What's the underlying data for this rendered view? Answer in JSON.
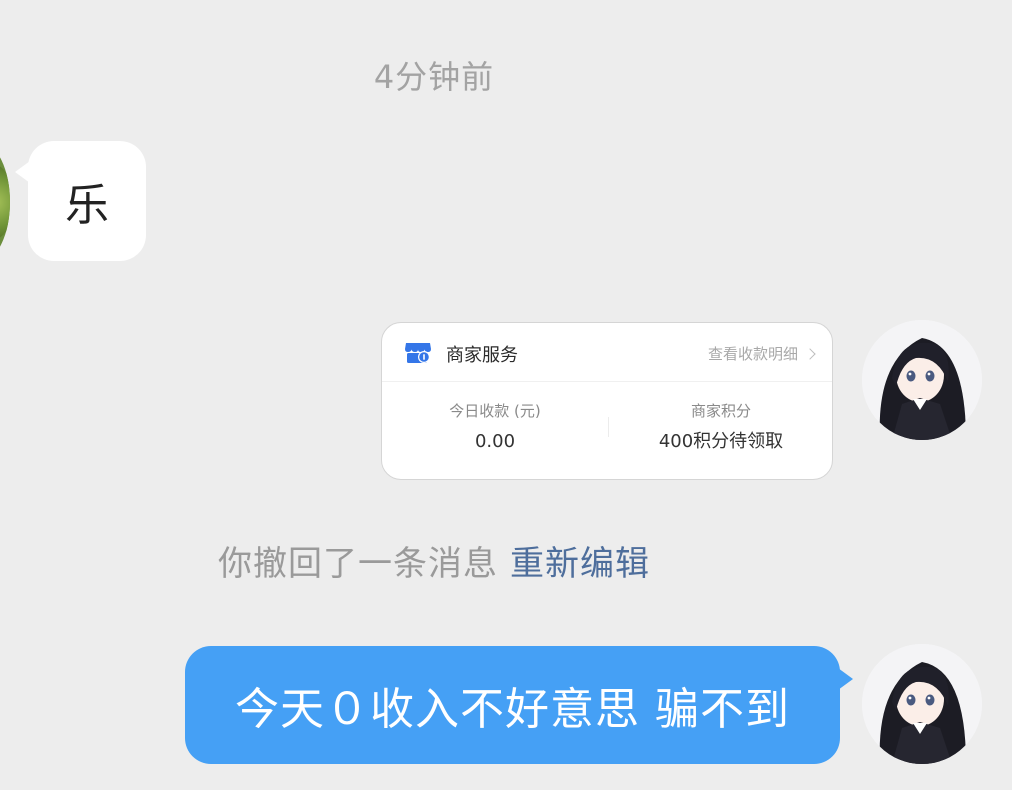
{
  "chat": {
    "timestamp": "4分钟前",
    "incoming_message": "乐",
    "recall_notice": "你撤回了一条消息",
    "recall_action": "重新编辑",
    "outgoing_message": "今天０收入不好意思 骗不到"
  },
  "service_card": {
    "title": "商家服务",
    "detail_link": "查看收款明细",
    "today_income_label": "今日收款 (元)",
    "today_income_value": "0.00",
    "points_label": "商家积分",
    "points_value": "400积分待领取"
  },
  "icons": {
    "store": "store-icon",
    "chevron": "chevron-right-icon"
  },
  "colors": {
    "background": "#ededed",
    "outgoing_bubble": "#45a0f5",
    "incoming_bubble": "#ffffff",
    "link": "#4e6e9c",
    "store_icon": "#3476e8"
  }
}
